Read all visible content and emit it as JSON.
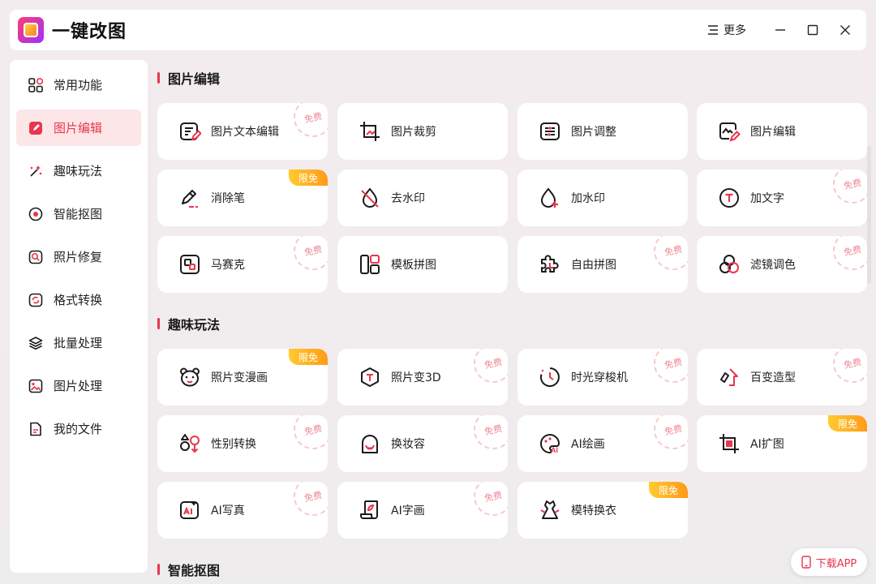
{
  "app": {
    "title": "一键改图",
    "more_label": "更多"
  },
  "sidebar": {
    "items": [
      {
        "label": "常用功能",
        "icon": "grid-icon"
      },
      {
        "label": "图片编辑",
        "icon": "edit-icon"
      },
      {
        "label": "趣味玩法",
        "icon": "magic-icon"
      },
      {
        "label": "智能抠图",
        "icon": "target-icon"
      },
      {
        "label": "照片修复",
        "icon": "repair-icon"
      },
      {
        "label": "格式转换",
        "icon": "convert-icon"
      },
      {
        "label": "批量处理",
        "icon": "layers-icon"
      },
      {
        "label": "图片处理",
        "icon": "image-icon"
      },
      {
        "label": "我的文件",
        "icon": "file-icon"
      }
    ],
    "active_index": 1
  },
  "sections": [
    {
      "title": "图片编辑",
      "cards": [
        {
          "label": "图片文本编辑",
          "icon": "text-edit-icon",
          "tag": "免费"
        },
        {
          "label": "图片裁剪",
          "icon": "crop-icon",
          "tag": ""
        },
        {
          "label": "图片调整",
          "icon": "adjust-icon",
          "tag": ""
        },
        {
          "label": "图片编辑",
          "icon": "image-edit-icon",
          "tag": ""
        },
        {
          "label": "消除笔",
          "icon": "eraser-pen-icon",
          "tag": "限免"
        },
        {
          "label": "去水印",
          "icon": "remove-watermark-icon",
          "tag": ""
        },
        {
          "label": "加水印",
          "icon": "add-watermark-icon",
          "tag": ""
        },
        {
          "label": "加文字",
          "icon": "add-text-icon",
          "tag": "免费"
        },
        {
          "label": "马赛克",
          "icon": "mosaic-icon",
          "tag": "免费"
        },
        {
          "label": "模板拼图",
          "icon": "template-collage-icon",
          "tag": ""
        },
        {
          "label": "自由拼图",
          "icon": "free-collage-icon",
          "tag": "免费"
        },
        {
          "label": "滤镜调色",
          "icon": "filter-icon",
          "tag": "免费"
        }
      ]
    },
    {
      "title": "趣味玩法",
      "cards": [
        {
          "label": "照片变漫画",
          "icon": "bear-face-icon",
          "tag": "限免"
        },
        {
          "label": "照片变3D",
          "icon": "cube-icon",
          "tag": "免费"
        },
        {
          "label": "时光穿梭机",
          "icon": "clock-icon",
          "tag": "免费"
        },
        {
          "label": "百变造型",
          "icon": "shape-icon",
          "tag": "免费"
        },
        {
          "label": "性别转换",
          "icon": "gender-icon",
          "tag": "免费"
        },
        {
          "label": "换妆容",
          "icon": "makeup-icon",
          "tag": "免费"
        },
        {
          "label": "AI绘画",
          "icon": "palette-icon",
          "tag": "免费"
        },
        {
          "label": "AI扩图",
          "icon": "expand-icon",
          "tag": "限免"
        },
        {
          "label": "AI写真",
          "icon": "ai-photo-icon",
          "tag": "免费"
        },
        {
          "label": "AI字画",
          "icon": "scroll-icon",
          "tag": "免费"
        },
        {
          "label": "模特换衣",
          "icon": "dress-icon",
          "tag": "限免"
        }
      ]
    },
    {
      "title": "智能抠图",
      "cards": []
    }
  ],
  "download": {
    "label": "下载APP"
  }
}
